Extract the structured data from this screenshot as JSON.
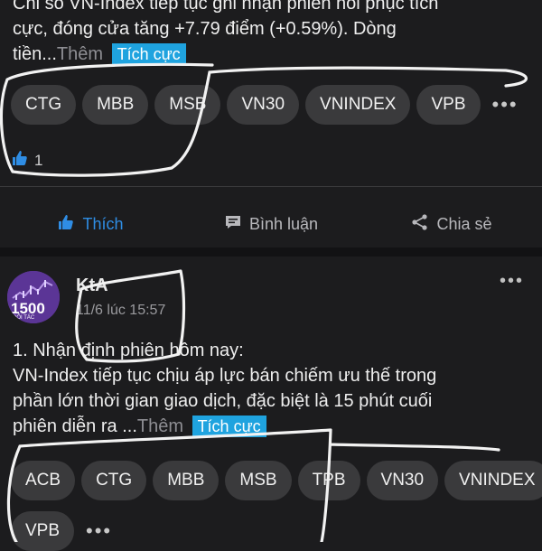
{
  "post1": {
    "text_line1": "Chỉ số VN-Index tiếp tục ghi nhận phiên hồi phục tích",
    "text_line2": "cực, đóng cửa tăng +7.79 điểm (+0.59%). Dòng",
    "text_line3": "tiền...",
    "more_label": "Thêm",
    "sentiment_tag": "Tích cực",
    "tickers": [
      "CTG",
      "MBB",
      "MSB",
      "VN30",
      "VNINDEX",
      "VPB"
    ],
    "overflow_label": "•••",
    "like_count": "1"
  },
  "actions": {
    "like_label": "Thích",
    "comment_label": "Bình luận",
    "share_label": "Chia sẻ"
  },
  "post2": {
    "author": "KtA",
    "timestamp": "11/6 lúc 15:57",
    "avatar_text": "1500",
    "avatar_subtext": "ĐỐI TÁC",
    "text_line1": "1. Nhận định phiên hôm nay:",
    "text_line2": "VN-Index tiếp tục chịu áp lực bán chiếm ưu thế trong",
    "text_line3": "phần lớn thời gian giao dịch, đặc biệt là 15 phút cuối",
    "text_line4": "phiên diễn ra ...",
    "more_label": "Thêm",
    "sentiment_tag": "Tích cực",
    "tickers": [
      "ACB",
      "CTG",
      "MBB",
      "MSB",
      "TPB",
      "VN30",
      "VNINDEX"
    ],
    "tickers_row2": [
      "VPB"
    ],
    "overflow_label": "•••"
  },
  "colors": {
    "background": "#1c1c1e",
    "chip": "#3a3a3c",
    "tag": "#1fa3df",
    "like_active": "#2f8de4"
  }
}
